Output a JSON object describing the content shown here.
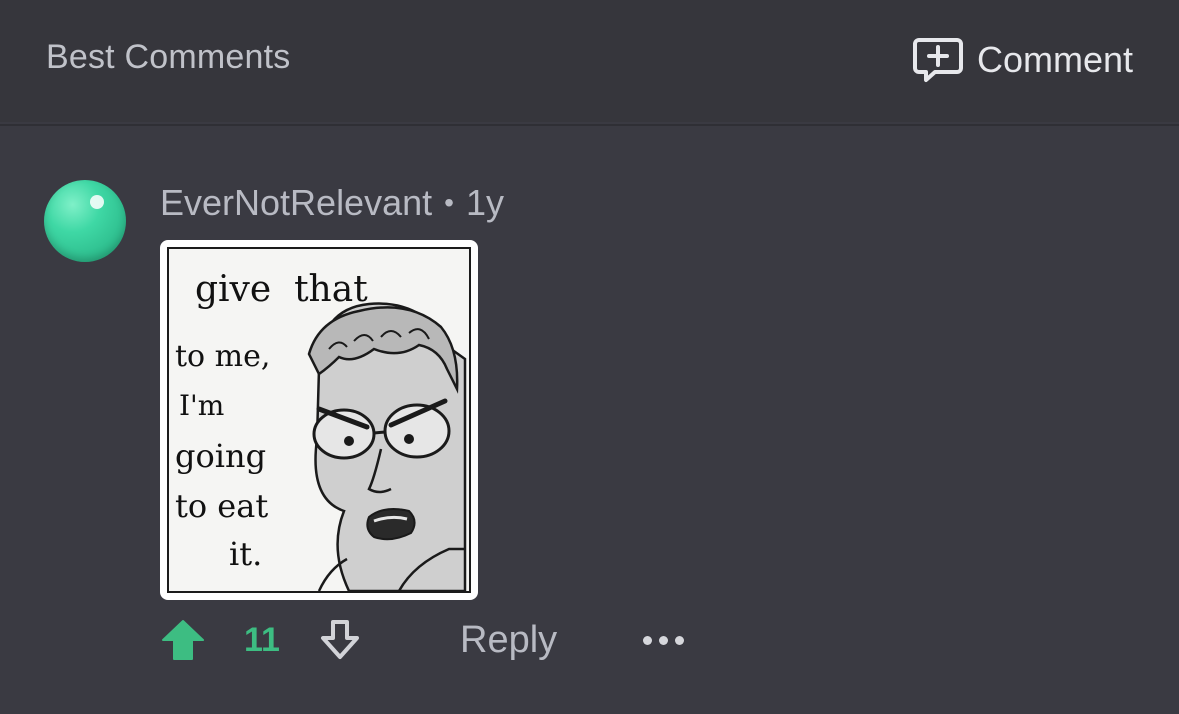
{
  "header": {
    "title": "Best Comments",
    "comment_button_label": "Comment",
    "comment_icon": "comment-plus-icon"
  },
  "comment": {
    "username": "EverNotRelevant",
    "separator": "•",
    "age": "1y",
    "avatar_color": "#3fd8a5",
    "image_caption": "give that to me, I'm going to eat it.",
    "votes": {
      "score": "11",
      "upvote_icon": "arrow-up-icon",
      "downvote_icon": "arrow-down-icon",
      "upvote_color": "#3dbd82"
    },
    "reply_label": "Reply",
    "more_icon": "more-dots-icon"
  }
}
